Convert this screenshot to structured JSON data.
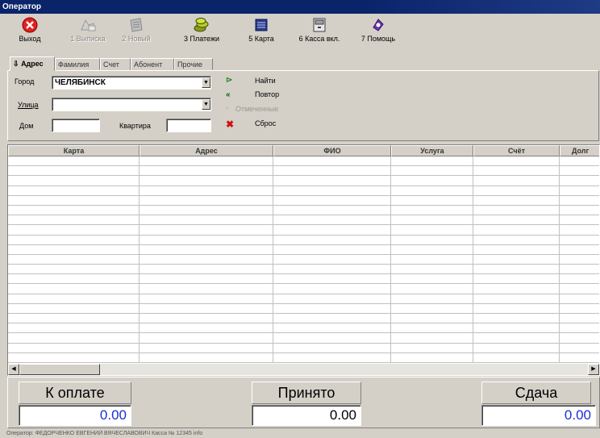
{
  "window": {
    "title": "Оператор"
  },
  "toolbar": [
    {
      "id": "exit",
      "label": "Выход",
      "icon": "exit-icon",
      "enabled": true
    },
    {
      "id": "statement",
      "label": "1 Выписка",
      "icon": "statement-icon",
      "enabled": false
    },
    {
      "id": "new",
      "label": "2 Новый",
      "icon": "new-icon",
      "enabled": false
    },
    {
      "id": "payments",
      "label": "3 Платежи",
      "icon": "payments-icon",
      "enabled": true
    },
    {
      "id": "card",
      "label": "5 Карта",
      "icon": "card-icon",
      "enabled": true
    },
    {
      "id": "cashbox",
      "label": "6 Касса вкл.",
      "icon": "cashbox-icon",
      "enabled": true
    },
    {
      "id": "help",
      "label": "7 Помощь",
      "icon": "help-icon",
      "enabled": true
    }
  ],
  "tabs": [
    "Адрес",
    "Фамилия",
    "Счет",
    "Абонент",
    "Прочие"
  ],
  "search": {
    "city_label": "Город",
    "city_value": "ЧЕЛЯБИНСК",
    "street_label": "Улица",
    "street_value": "",
    "house_label": "Дом",
    "house_value": "",
    "apartment_label": "Квартира",
    "apartment_value": ""
  },
  "actions": {
    "find": "Найти",
    "repeat": "Повтор",
    "marked": "Отмеченные",
    "reset": "Сброс"
  },
  "grid": {
    "columns": [
      "Карта",
      "Адрес",
      "ФИО",
      "Услуга",
      "Счёт",
      "Долг"
    ]
  },
  "totals": {
    "to_pay_label": "К оплате",
    "to_pay_value": "0.00",
    "received_label": "Принято",
    "received_value": "0.00",
    "change_label": "Сдача",
    "change_value": "0.00"
  },
  "status": {
    "text": "Оператор: ФЕДОРЧЕНКО ЕВГЕНИЙ ВЯЧЕСЛАВОВИЧ  Касса № 12345 info"
  },
  "colors": {
    "title_bar": "#0a246a",
    "accent_blue": "#1a2fd6",
    "window_bg": "#d4d0c8"
  }
}
